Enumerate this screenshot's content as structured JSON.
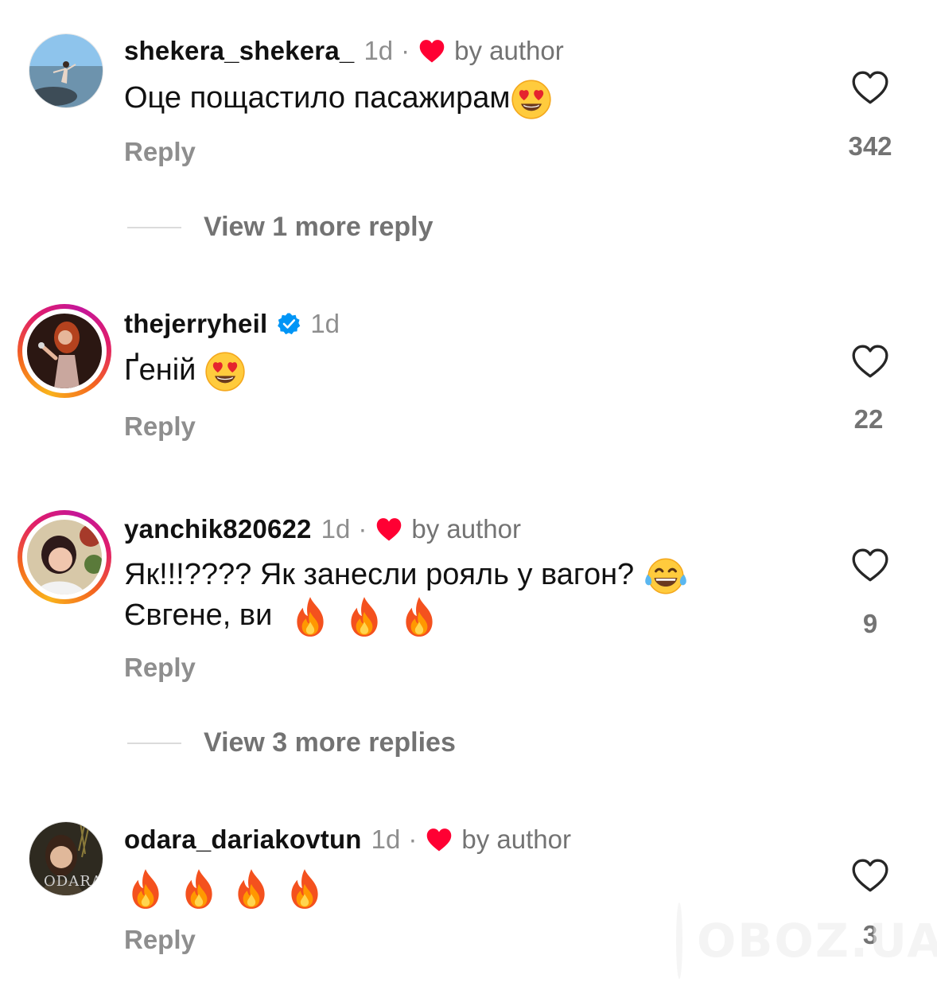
{
  "comments": [
    {
      "username": "shekera_shekera_",
      "time": "1d",
      "separator": "·",
      "author_like": "by author",
      "text": "Оце пощастило пасажирам",
      "reply_label": "Reply",
      "likes": "342",
      "view_more": "View 1 more reply"
    },
    {
      "username": "thejerryheil",
      "time": "1d",
      "text": "Ґеній",
      "reply_label": "Reply",
      "likes": "22"
    },
    {
      "username": "yanchik820622",
      "time": "1d",
      "separator": "·",
      "author_like": "by author",
      "text_line1": "Як!!!???? Як занесли рояль у вагон?",
      "text_line2": "Євгене, ви",
      "reply_label": "Reply",
      "likes": "9",
      "view_more": "View 3 more replies"
    },
    {
      "username": "odara_dariakovtun",
      "time": "1d",
      "separator": "·",
      "author_like": "by author",
      "avatar_caption": "ODARA",
      "reply_label": "Reply",
      "likes": "3"
    }
  ],
  "watermark": "OBOZ.UA",
  "colors": {
    "heart_red": "#ff0033",
    "verified_blue": "#0095f6",
    "muted_text": "#8e8e8e",
    "story_ring": [
      "#f9b31c",
      "#e01d6b",
      "#c4169a"
    ]
  },
  "icons": {
    "like": "heart-outline-icon",
    "author_like": "red-heart-icon",
    "verified": "verified-badge-icon",
    "emoji_love": "heart-eyes-emoji",
    "emoji_laugh": "tears-of-joy-emoji",
    "emoji_fire": "fire-emoji"
  }
}
